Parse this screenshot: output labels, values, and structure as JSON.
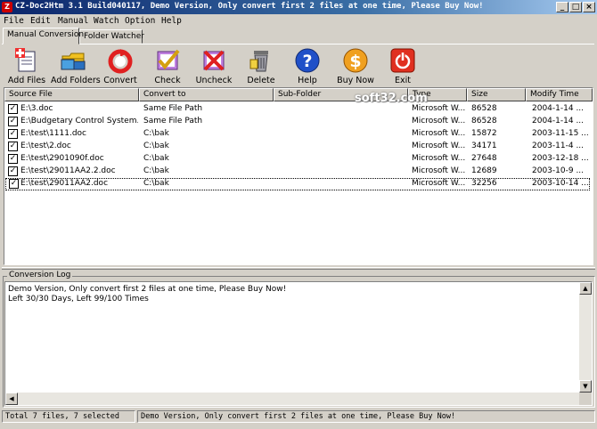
{
  "window": {
    "title": "CZ-Doc2Htm 3.1 Build040117, Demo Version, Only convert first 2 files at one time, Please Buy Now!",
    "controls": [
      "_",
      "□",
      "×"
    ]
  },
  "menu": [
    "File",
    "Edit",
    "Manual",
    "Watch",
    "Option",
    "Help"
  ],
  "tabs": [
    "Manual Conversion",
    "Folder Watcher"
  ],
  "toolbar": [
    {
      "label": "Add Files",
      "icon": "add-files-icon"
    },
    {
      "label": "Add Folders",
      "icon": "add-folders-icon"
    },
    {
      "label": "Convert",
      "icon": "convert-icon"
    },
    {
      "label": "Check",
      "icon": "check-icon"
    },
    {
      "label": "Uncheck",
      "icon": "uncheck-icon"
    },
    {
      "label": "Delete",
      "icon": "delete-icon"
    },
    {
      "label": "Help",
      "icon": "help-icon"
    },
    {
      "label": "Buy Now",
      "icon": "buy-now-icon"
    },
    {
      "label": "Exit",
      "icon": "exit-icon"
    }
  ],
  "columns": [
    "Source File",
    "Convert to",
    "Sub-Folder",
    "Type",
    "Size",
    "Modify Time"
  ],
  "rows": [
    {
      "checked": true,
      "source": "E:\\3.doc",
      "convert_to": "Same File Path",
      "sub_folder": "",
      "type": "Microsoft W...",
      "size": "86528",
      "modified": "2004-1-14 ..."
    },
    {
      "checked": true,
      "source": "E:\\Budgetary Control System.doc",
      "convert_to": "Same File Path",
      "sub_folder": "",
      "type": "Microsoft W...",
      "size": "86528",
      "modified": "2004-1-14 ..."
    },
    {
      "checked": true,
      "source": "E:\\test\\1111.doc",
      "convert_to": "C:\\bak",
      "sub_folder": "",
      "type": "Microsoft W...",
      "size": "15872",
      "modified": "2003-11-15 ..."
    },
    {
      "checked": true,
      "source": "E:\\test\\2.doc",
      "convert_to": "C:\\bak",
      "sub_folder": "",
      "type": "Microsoft W...",
      "size": "34171",
      "modified": "2003-11-4 ..."
    },
    {
      "checked": true,
      "source": "E:\\test\\2901090f.doc",
      "convert_to": "C:\\bak",
      "sub_folder": "",
      "type": "Microsoft W...",
      "size": "27648",
      "modified": "2003-12-18 ..."
    },
    {
      "checked": true,
      "source": "E:\\test\\29011AA2.2.doc",
      "convert_to": "C:\\bak",
      "sub_folder": "",
      "type": "Microsoft W...",
      "size": "12689",
      "modified": "2003-10-9 ..."
    },
    {
      "checked": true,
      "source": "E:\\test\\29011AA2.doc",
      "convert_to": "C:\\bak",
      "sub_folder": "",
      "type": "Microsoft W...",
      "size": "32256",
      "modified": "2003-10-14 ..."
    }
  ],
  "watermark": "soft32.com",
  "log": {
    "title": "Conversion Log",
    "lines": [
      "Demo Version, Only convert first 2 files at one time, Please Buy Now!",
      "Left 30/30 Days, Left 99/100 Times"
    ]
  },
  "status": {
    "left": "Total 7 files, 7 selected",
    "right": "Demo Version, Only convert first 2 files at one time, Please Buy Now!"
  },
  "colors": {
    "title_start": "#0a246a",
    "title_end": "#a6caf0",
    "face": "#d4d0c8"
  }
}
